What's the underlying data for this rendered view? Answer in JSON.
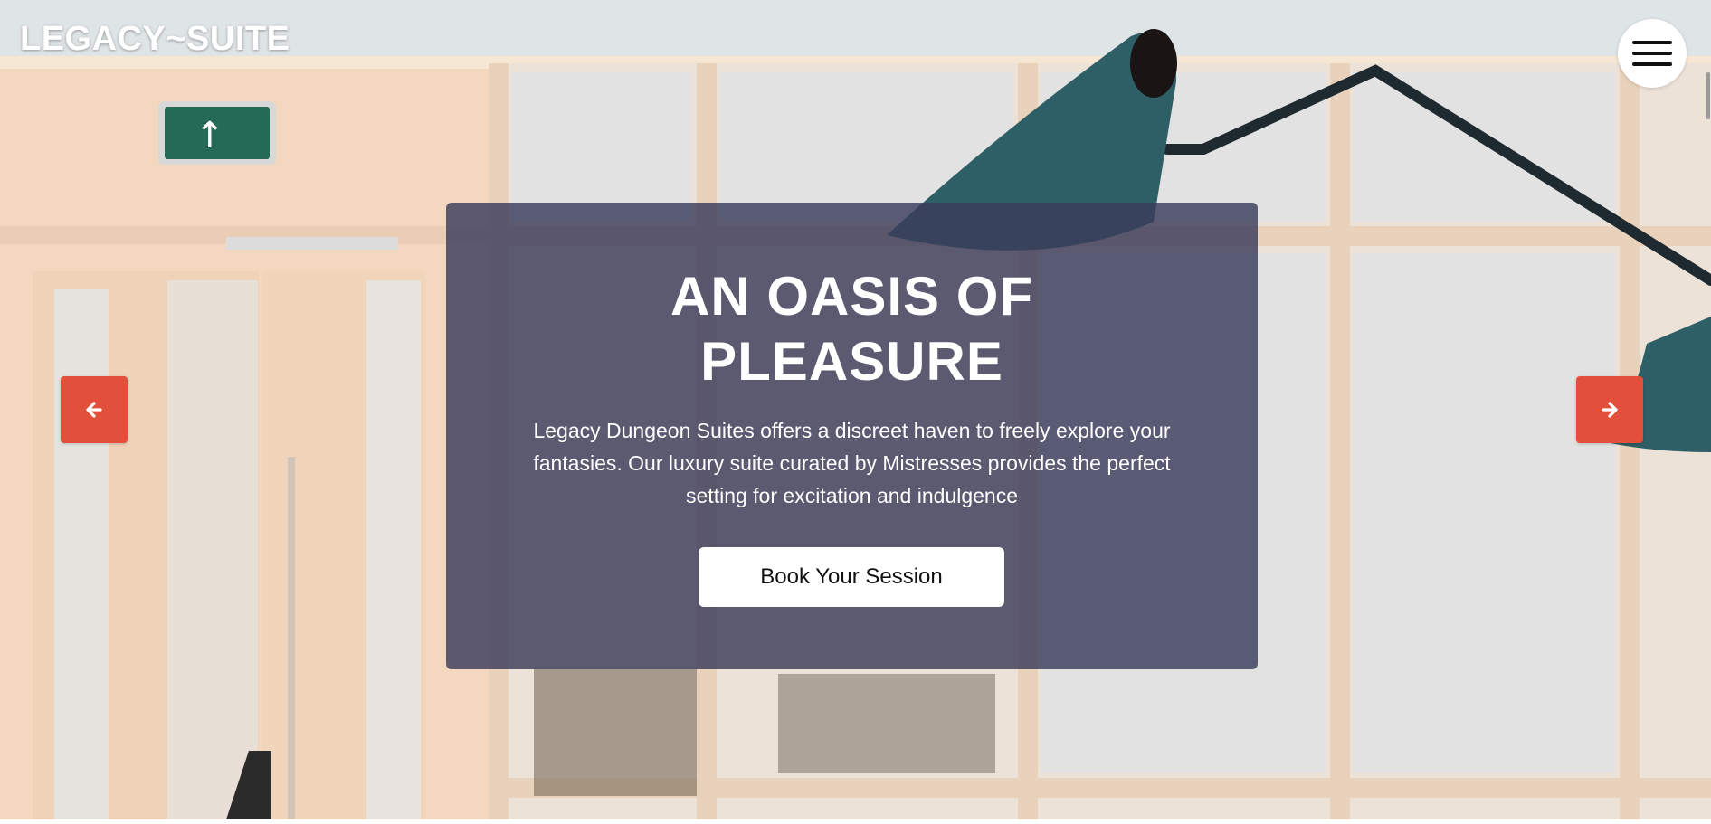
{
  "brand": {
    "name": "LEGACY~SUITE"
  },
  "header": {
    "menu_icon": "hamburger-menu-icon"
  },
  "carousel": {
    "prev_icon": "arrow-left-icon",
    "next_icon": "arrow-right-icon"
  },
  "hero": {
    "title_line1": "AN OASIS OF",
    "title_line2": "PLEASURE",
    "description": "Legacy Dungeon Suites offers a discreet haven to freely explore your fantasies. Our luxury suite curated by Mistresses provides the perfect setting for excitation and indulgence",
    "cta_label": "Book Your Session"
  },
  "colors": {
    "accent": "#e2503b",
    "card_overlay": "#3a3c5a",
    "text_light": "#ffffff"
  }
}
